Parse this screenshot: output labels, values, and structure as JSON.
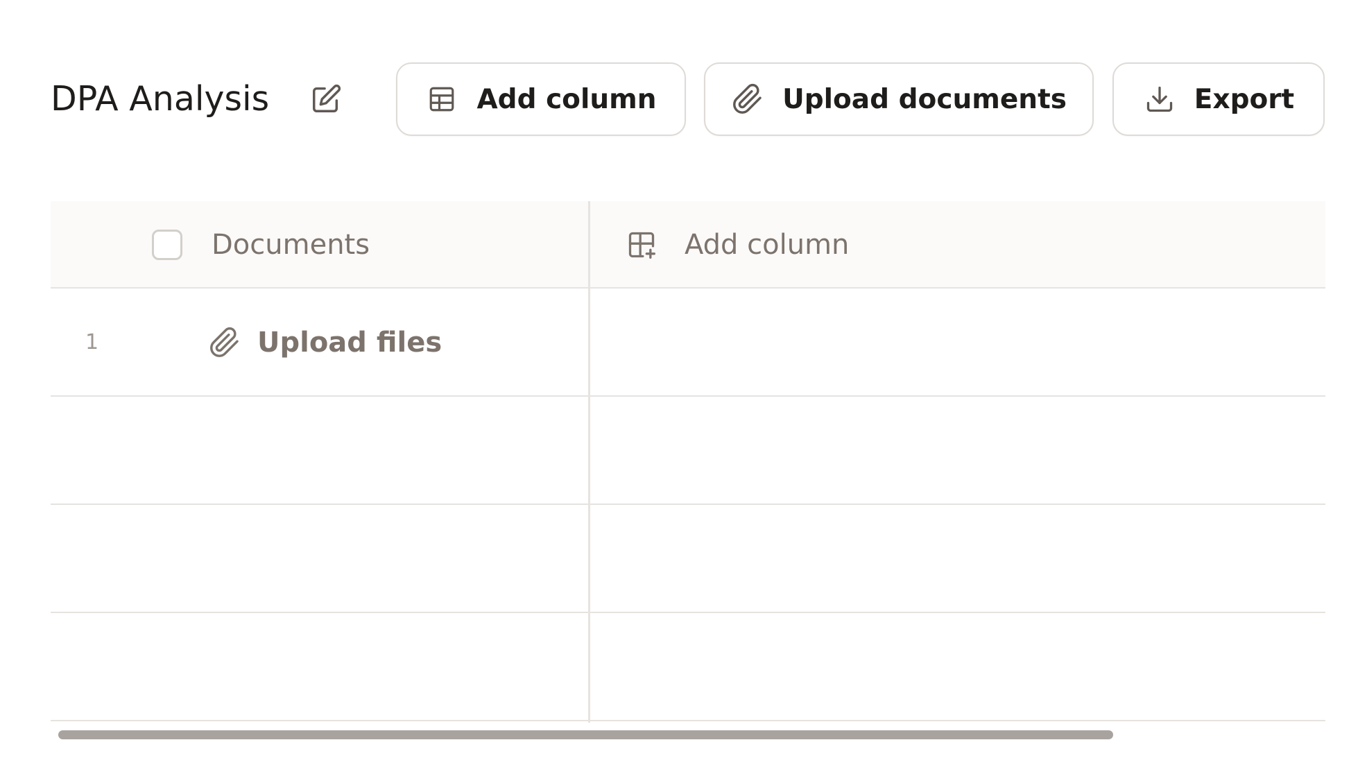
{
  "header": {
    "title": "DPA Analysis",
    "buttons": {
      "add_column": "Add column",
      "upload_documents": "Upload documents",
      "export": "Export"
    }
  },
  "table": {
    "columns": {
      "documents": "Documents",
      "add_column": "Add column"
    },
    "rows": [
      {
        "number": "1",
        "action_label": "Upload files"
      }
    ]
  },
  "icons": {
    "edit": "edit-icon",
    "table": "table-icon",
    "paperclip": "paperclip-icon",
    "download": "download-icon",
    "add_column": "add-column-icon"
  },
  "colors": {
    "text_primary": "#1f1d1b",
    "text_muted": "#7c736c",
    "border": "#dedad6",
    "scrollbar": "#a9a39f"
  }
}
